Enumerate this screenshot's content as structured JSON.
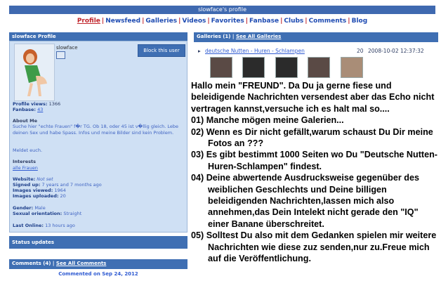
{
  "header": {
    "title": "slowface's profile"
  },
  "nav": {
    "items": [
      {
        "label": "Profile",
        "active": true
      },
      {
        "label": "Newsfeed"
      },
      {
        "label": "Galleries"
      },
      {
        "label": "Videos"
      },
      {
        "label": "Favorites"
      },
      {
        "label": "Fanbase"
      },
      {
        "label": "Clubs"
      },
      {
        "label": "Comments"
      },
      {
        "label": "Blog"
      }
    ]
  },
  "profile": {
    "panel_title": "slowface Profile",
    "username": "slowface",
    "block_label": "Block this user",
    "views_label": "Profile views:",
    "views_value": "1366",
    "fanbase_label": "Fanbase:",
    "fanbase_value": "43",
    "about_label": "About Me",
    "about_text": "Suche hier \"echte Frauen\" f�r TG. Ob 18, oder 45 ist v�llig gleich. Lebe deinen Sex und habe Spass. Infos und meine Bilder sind kein Problem.",
    "meldet": "Meldet euch.",
    "interests_label": "Interests",
    "interests_value": "alle Frauen",
    "website_label": "Website:",
    "website_value": "Not set",
    "signed_label": "Signed up:",
    "signed_value": "7 years and 7 months ago",
    "images_viewed_label": "Images viewed:",
    "images_viewed_value": "1964",
    "images_uploaded_label": "Images uploaded:",
    "images_uploaded_value": "20",
    "gender_label": "Gender:",
    "gender_value": "Male",
    "orientation_label": "Sexual orientation:",
    "orientation_value": "Straight",
    "last_online_label": "Last Online:",
    "last_online_value": "13 hours ago"
  },
  "status": {
    "title": "Status updates"
  },
  "comments": {
    "title": "Comments (4)",
    "see_all": "See All Comments",
    "commented_on": "Commented on Sep 24, 2012"
  },
  "galleries": {
    "title": "Galleries (1)",
    "see_all": "See All Galleries",
    "row": {
      "name": "deutsche Nutten - Huren - Schlampen",
      "count": "20",
      "date": "2008-10-02 12:37:32"
    }
  },
  "message": {
    "intro": "Hallo mein \"FREUND\". Da Du ja gerne fiese und beleidigende  Nachrichten versendest aber das Echo nicht vertragen kannst,versuche ich es halt mal so....",
    "items": [
      "01) Manche mögen meine Galerien...",
      "02) Wenn es Dir nicht gefällt,warum schaust Du Dir meine Fotos an ???",
      "03) Es gibt bestimmt 1000 Seiten wo Du \"Deutsche Nutten-Huren-Schlampen\" findest.",
      "04) Deine abwertende Ausdrucksweise gegenüber des weiblichen Geschlechts und Deine billigen beleidigenden Nachrichten,lassen mich also annehmen,das Dein Intelekt nicht gerade den \"IQ\" einer Banane überschreitet.",
      "05) Solltest Du also mit dem Gedanken spielen mir weitere Nachrichten wie diese zuz senden,nur zu.Freue mich auf die Veröffentlichung."
    ]
  }
}
